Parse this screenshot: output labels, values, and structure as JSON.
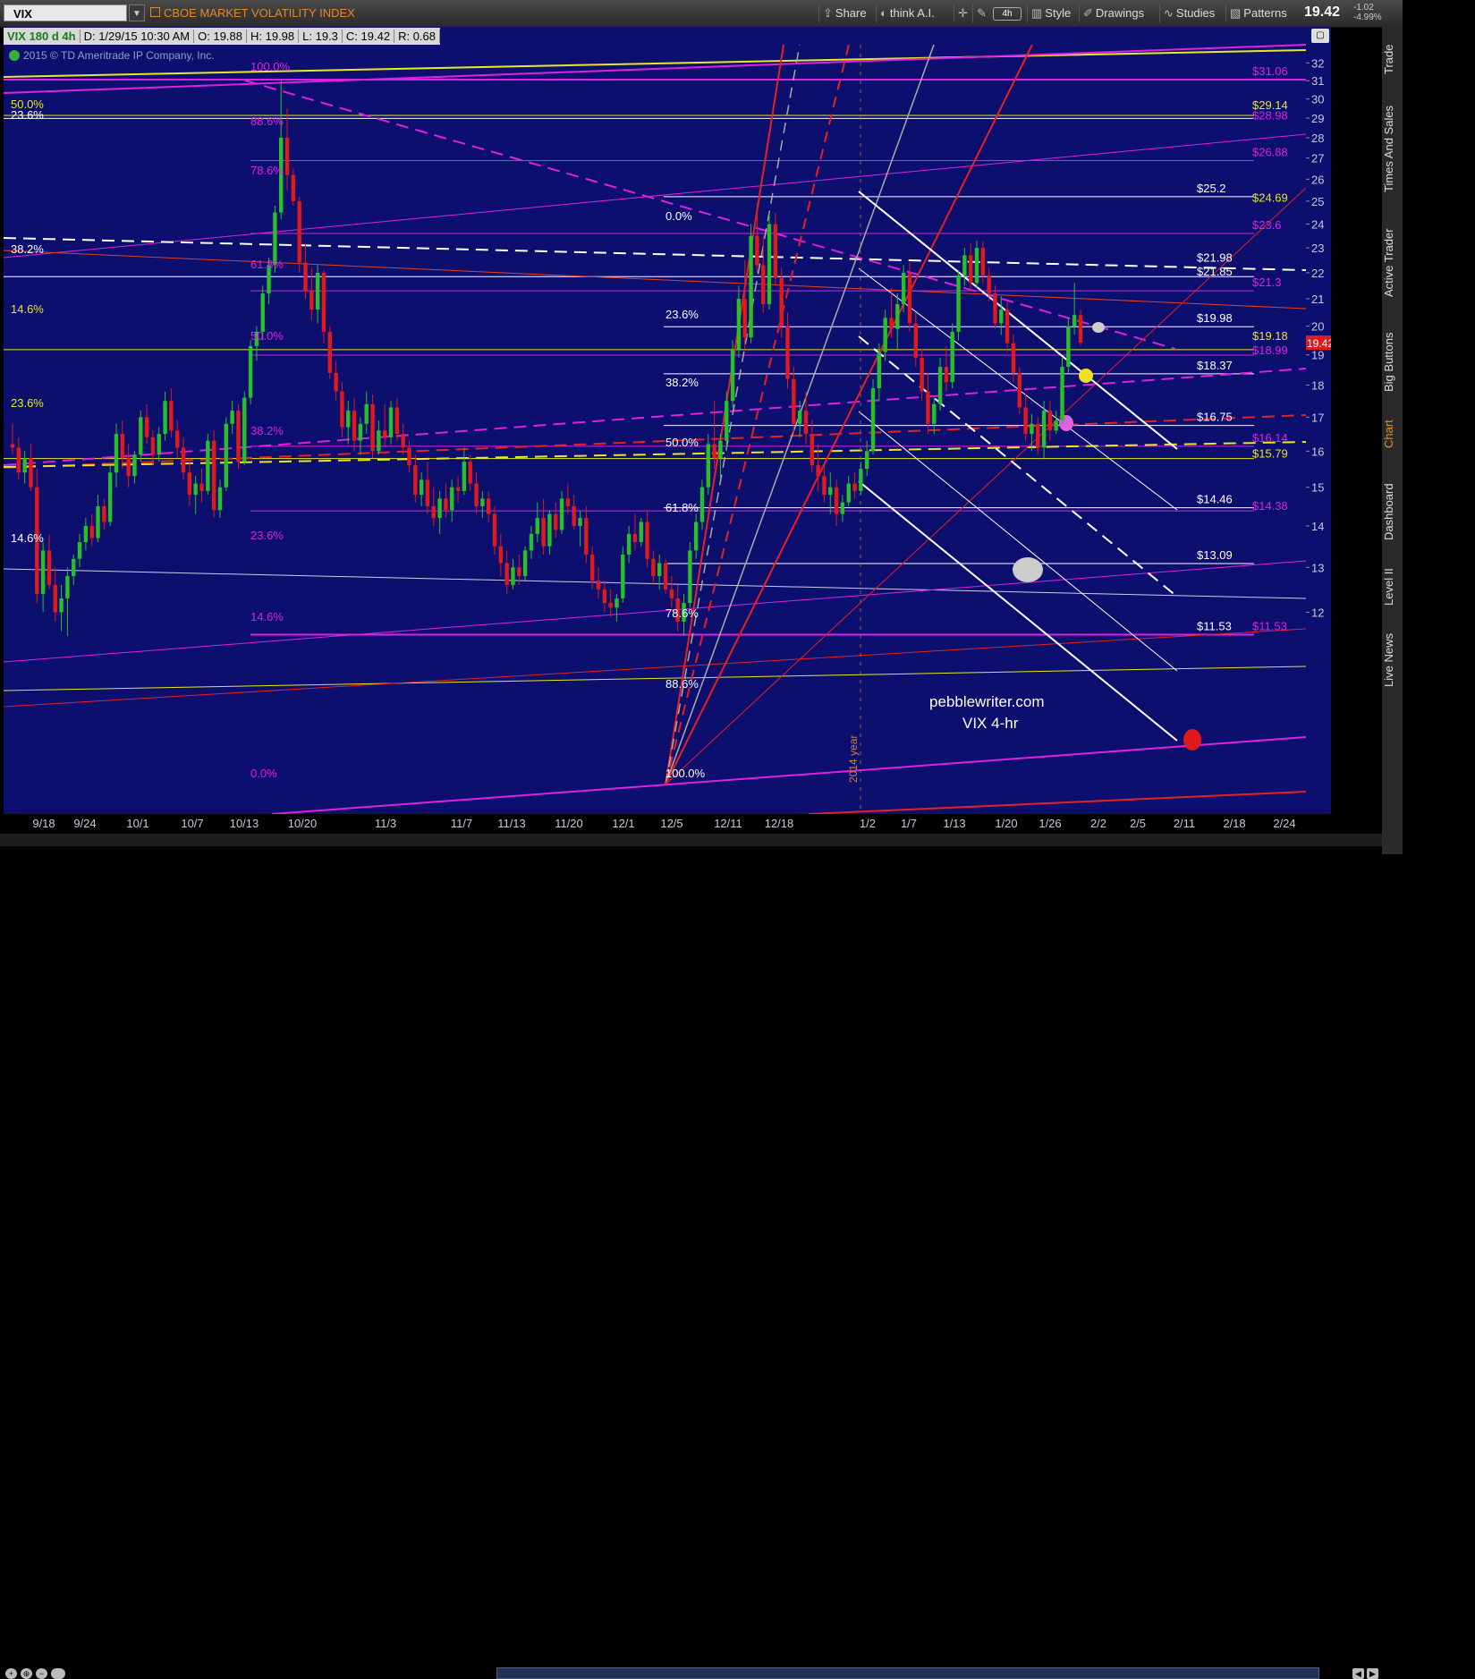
{
  "toolbar": {
    "symbol": "VIX",
    "symbol_name": "CBOE MARKET VOLATILITY INDEX",
    "share": "Share",
    "think": "think A.I.",
    "aggregation": "4h",
    "style": "Style",
    "drawings": "Drawings",
    "studies": "Studies",
    "patterns": "Patterns",
    "last": "19.42",
    "change": "-1.02",
    "change_pct": "-4.99%"
  },
  "info": {
    "sym": "VIX 180 d 4h",
    "date": "D: 1/29/15 10:30 AM",
    "open": "O: 19.88",
    "high": "H: 19.98",
    "low": "L: 19.3",
    "close": "C: 19.42",
    "range": "R: 0.68"
  },
  "copyright": "2015 © TD Ameritrade IP Company, Inc.",
  "sidebar": [
    "Trade",
    "Times And Sales",
    "Active Trader",
    "Big Buttons",
    "Chart",
    "Dashboard",
    "Level II",
    "Live News"
  ],
  "colors": {
    "bg": "#0c0f6e",
    "up": "#28c028",
    "down": "#e01a1a",
    "magenta": "#e020e0",
    "yellow": "#e8e820",
    "red": "#e82020",
    "white": "#ffffff"
  },
  "chart_data": {
    "type": "candlestick",
    "title": "CBOE MARKET VOLATILITY INDEX",
    "x_tick_labels": [
      "9/18",
      "9/24",
      "10/1",
      "10/7",
      "10/13",
      "10/20",
      "11/3",
      "11/7",
      "11/13",
      "11/20",
      "12/1",
      "12/5",
      "12/11",
      "12/18",
      "1/2",
      "1/7",
      "1/13",
      "1/20",
      "1/26",
      "2/2",
      "2/5",
      "2/11",
      "2/18",
      "2/24"
    ],
    "ylim": [
      11,
      32
    ],
    "y_ticks": [
      12,
      13,
      14,
      15,
      16,
      17,
      18,
      19,
      20,
      21,
      22,
      23,
      24,
      25,
      26,
      27,
      28,
      29,
      30,
      31,
      32
    ],
    "last_price": 19.42,
    "price_labels": [
      {
        "text": "$31.06",
        "value": 31.06,
        "color": "#e020e0"
      },
      {
        "text": "$29.14",
        "value": 29.14,
        "color": "#e8e820"
      },
      {
        "text": "$28.98",
        "value": 28.98,
        "color": "#e020e0"
      },
      {
        "text": "$26.88",
        "value": 26.88,
        "color": "#e020e0"
      },
      {
        "text": "$25.2",
        "value": 25.2,
        "color": "#ffffff"
      },
      {
        "text": "$24.69",
        "value": 24.69,
        "color": "#e8e820"
      },
      {
        "text": "$23.6",
        "value": 23.6,
        "color": "#e020e0"
      },
      {
        "text": "$21.98",
        "value": 21.98,
        "color": "#ffffff"
      },
      {
        "text": "$21.85",
        "value": 21.85,
        "color": "#ffffff"
      },
      {
        "text": "$21.3",
        "value": 21.3,
        "color": "#e020e0"
      },
      {
        "text": "$19.98",
        "value": 19.98,
        "color": "#ffffff"
      },
      {
        "text": "$19.18",
        "value": 19.18,
        "color": "#e8e820"
      },
      {
        "text": "$18.99",
        "value": 18.99,
        "color": "#e020e0"
      },
      {
        "text": "$18.37",
        "value": 18.37,
        "color": "#ffffff"
      },
      {
        "text": "$16.75",
        "value": 16.75,
        "color": "#ffffff"
      },
      {
        "text": "$16.14",
        "value": 16.14,
        "color": "#e020e0"
      },
      {
        "text": "$15.79",
        "value": 15.79,
        "color": "#e8e820"
      },
      {
        "text": "$14.46",
        "value": 14.46,
        "color": "#ffffff"
      },
      {
        "text": "$14.38",
        "value": 14.38,
        "color": "#e020e0"
      },
      {
        "text": "$13.09",
        "value": 13.09,
        "color": "#ffffff"
      },
      {
        "text": "$11.53",
        "value": 11.53,
        "color": "#ffffff"
      },
      {
        "text": "$11.53",
        "value": 11.53,
        "color": "#e020e0"
      }
    ],
    "fib_left_white": [
      {
        "text": "50.0%"
      },
      {
        "text": "23.6%"
      },
      {
        "text": "38.2%"
      },
      {
        "text": "14.6%"
      },
      {
        "text": "23.6%"
      },
      {
        "text": "14.6%"
      }
    ],
    "fib_mag": [
      {
        "text": "100.0%"
      },
      {
        "text": "88.6%"
      },
      {
        "text": "78.6%"
      },
      {
        "text": "61.8%"
      },
      {
        "text": "50.0%"
      },
      {
        "text": "38.2%"
      },
      {
        "text": "23.6%"
      },
      {
        "text": "14.6%"
      },
      {
        "text": "0.0%"
      }
    ],
    "fib_mid": [
      {
        "text": "0.0%"
      },
      {
        "text": "23.6%"
      },
      {
        "text": "38.2%"
      },
      {
        "text": "50.0%"
      },
      {
        "text": "61.8%"
      },
      {
        "text": "78.6%"
      },
      {
        "text": "88.6%"
      },
      {
        "text": "100.0%"
      }
    ],
    "annotations": [
      "pebblewriter.com",
      "VIX 4-hr",
      "2014 year"
    ],
    "candles": [
      [
        16.2,
        16.8,
        15.9,
        16.1
      ],
      [
        16.1,
        16.4,
        15.2,
        15.4
      ],
      [
        15.4,
        16.0,
        15.1,
        15.8
      ],
      [
        15.8,
        16.2,
        14.9,
        15.0
      ],
      [
        15.0,
        15.5,
        12.2,
        12.4
      ],
      [
        12.4,
        13.6,
        12.0,
        13.4
      ],
      [
        13.4,
        13.8,
        12.5,
        12.6
      ],
      [
        12.6,
        13.0,
        11.8,
        12.0
      ],
      [
        12.0,
        12.6,
        11.6,
        12.3
      ],
      [
        12.3,
        13.0,
        11.5,
        12.8
      ],
      [
        12.8,
        13.3,
        12.6,
        13.2
      ],
      [
        13.2,
        13.8,
        13.0,
        13.6
      ],
      [
        13.6,
        14.2,
        13.4,
        14.0
      ],
      [
        14.0,
        14.3,
        13.5,
        13.7
      ],
      [
        13.7,
        14.8,
        13.6,
        14.5
      ],
      [
        14.5,
        14.7,
        13.9,
        14.1
      ],
      [
        14.1,
        15.6,
        14.0,
        15.4
      ],
      [
        15.4,
        16.8,
        15.0,
        16.5
      ],
      [
        16.5,
        16.9,
        15.5,
        15.8
      ],
      [
        15.8,
        16.2,
        15.0,
        15.3
      ],
      [
        15.3,
        16.0,
        15.1,
        15.9
      ],
      [
        15.9,
        17.2,
        15.7,
        17.0
      ],
      [
        17.0,
        17.4,
        16.2,
        16.4
      ],
      [
        16.4,
        16.6,
        15.6,
        15.9
      ],
      [
        15.9,
        16.7,
        15.7,
        16.5
      ],
      [
        16.5,
        17.8,
        16.3,
        17.5
      ],
      [
        17.5,
        17.9,
        16.4,
        16.6
      ],
      [
        16.6,
        16.9,
        15.8,
        16.1
      ],
      [
        16.1,
        16.4,
        15.2,
        15.4
      ],
      [
        15.4,
        15.8,
        14.5,
        14.8
      ],
      [
        14.8,
        15.3,
        14.3,
        15.1
      ],
      [
        15.1,
        15.5,
        14.6,
        14.9
      ],
      [
        14.9,
        16.5,
        14.8,
        16.3
      ],
      [
        16.3,
        16.6,
        14.2,
        14.4
      ],
      [
        14.4,
        15.2,
        14.2,
        15.0
      ],
      [
        15.0,
        17.0,
        14.9,
        16.8
      ],
      [
        16.8,
        17.5,
        16.5,
        17.2
      ],
      [
        17.2,
        17.4,
        15.5,
        15.7
      ],
      [
        15.7,
        17.8,
        15.6,
        17.6
      ],
      [
        17.6,
        19.5,
        17.4,
        19.3
      ],
      [
        19.3,
        20.0,
        18.8,
        19.8
      ],
      [
        19.8,
        21.5,
        19.5,
        21.2
      ],
      [
        21.2,
        22.6,
        20.8,
        22.3
      ],
      [
        22.3,
        24.8,
        22.0,
        24.5
      ],
      [
        24.5,
        31.0,
        24.2,
        28.0
      ],
      [
        28.0,
        29.5,
        25.5,
        26.2
      ],
      [
        26.2,
        26.5,
        24.8,
        25.0
      ],
      [
        25.0,
        25.2,
        22.0,
        22.4
      ],
      [
        22.4,
        23.2,
        21.0,
        21.3
      ],
      [
        21.3,
        22.2,
        20.2,
        20.6
      ],
      [
        20.6,
        22.3,
        20.1,
        22.0
      ],
      [
        22.0,
        22.1,
        19.4,
        19.8
      ],
      [
        19.8,
        20.0,
        18.2,
        18.4
      ],
      [
        18.4,
        18.8,
        17.5,
        17.8
      ],
      [
        17.8,
        18.1,
        16.4,
        16.7
      ],
      [
        16.7,
        17.5,
        16.2,
        17.2
      ],
      [
        17.2,
        17.6,
        16.0,
        16.3
      ],
      [
        16.3,
        17.0,
        15.9,
        16.8
      ],
      [
        16.8,
        17.8,
        16.5,
        17.4
      ],
      [
        17.4,
        17.7,
        15.8,
        16.0
      ],
      [
        16.0,
        16.9,
        15.9,
        16.6
      ],
      [
        16.6,
        17.4,
        16.1,
        16.4
      ],
      [
        16.4,
        17.5,
        16.2,
        17.3
      ],
      [
        17.3,
        17.6,
        16.3,
        16.5
      ],
      [
        16.5,
        16.8,
        15.9,
        16.1
      ],
      [
        16.1,
        16.3,
        15.4,
        15.6
      ],
      [
        15.6,
        15.9,
        14.6,
        14.8
      ],
      [
        14.8,
        15.4,
        14.5,
        15.2
      ],
      [
        15.2,
        15.7,
        14.3,
        14.5
      ],
      [
        14.5,
        15.0,
        14.0,
        14.2
      ],
      [
        14.2,
        14.9,
        13.8,
        14.7
      ],
      [
        14.7,
        15.1,
        14.2,
        14.4
      ],
      [
        14.4,
        15.2,
        14.1,
        15.0
      ],
      [
        15.0,
        15.3,
        14.6,
        14.9
      ],
      [
        14.9,
        16.1,
        14.8,
        15.7
      ],
      [
        15.7,
        15.9,
        14.9,
        15.1
      ],
      [
        15.1,
        15.4,
        14.3,
        14.5
      ],
      [
        14.5,
        14.9,
        14.2,
        14.7
      ],
      [
        14.7,
        14.9,
        14.1,
        14.3
      ],
      [
        14.3,
        14.5,
        13.3,
        13.5
      ],
      [
        13.5,
        13.8,
        12.8,
        13.1
      ],
      [
        13.1,
        13.4,
        12.4,
        12.6
      ],
      [
        12.6,
        13.2,
        12.5,
        13.0
      ],
      [
        13.0,
        13.3,
        12.6,
        12.8
      ],
      [
        12.8,
        13.5,
        12.7,
        13.4
      ],
      [
        13.4,
        14.0,
        13.2,
        13.8
      ],
      [
        13.8,
        14.6,
        13.6,
        14.2
      ],
      [
        14.2,
        14.7,
        13.3,
        13.5
      ],
      [
        13.5,
        14.4,
        13.3,
        14.3
      ],
      [
        14.3,
        14.6,
        13.7,
        13.9
      ],
      [
        13.9,
        14.9,
        13.8,
        14.7
      ],
      [
        14.7,
        15.1,
        14.3,
        14.5
      ],
      [
        14.5,
        14.8,
        13.9,
        14.0
      ],
      [
        14.0,
        14.4,
        13.5,
        14.2
      ],
      [
        14.2,
        14.5,
        13.1,
        13.3
      ],
      [
        13.3,
        13.5,
        12.5,
        12.7
      ],
      [
        12.7,
        13.0,
        12.3,
        12.5
      ],
      [
        12.5,
        12.7,
        12.0,
        12.2
      ],
      [
        12.2,
        12.5,
        11.9,
        12.1
      ],
      [
        12.1,
        12.4,
        11.8,
        12.3
      ],
      [
        12.3,
        13.5,
        12.2,
        13.3
      ],
      [
        13.3,
        14.0,
        13.1,
        13.8
      ],
      [
        13.8,
        14.3,
        13.4,
        13.6
      ],
      [
        13.6,
        14.2,
        13.5,
        14.1
      ],
      [
        14.1,
        14.4,
        13.0,
        13.2
      ],
      [
        13.2,
        13.4,
        12.6,
        12.8
      ],
      [
        12.8,
        13.3,
        12.5,
        13.1
      ],
      [
        13.1,
        13.2,
        12.4,
        12.5
      ],
      [
        12.5,
        12.8,
        12.1,
        12.3
      ],
      [
        12.3,
        12.6,
        11.6,
        11.8
      ],
      [
        11.8,
        12.4,
        11.5,
        12.2
      ],
      [
        12.2,
        13.6,
        12.1,
        13.4
      ],
      [
        13.4,
        14.3,
        13.2,
        14.1
      ],
      [
        14.1,
        15.2,
        13.9,
        15.0
      ],
      [
        15.0,
        16.5,
        14.8,
        16.2
      ],
      [
        16.2,
        17.5,
        15.5,
        15.8
      ],
      [
        15.8,
        16.5,
        15.2,
        16.3
      ],
      [
        16.3,
        17.8,
        16.0,
        17.5
      ],
      [
        17.5,
        19.5,
        17.3,
        19.2
      ],
      [
        19.2,
        21.5,
        18.9,
        21.0
      ],
      [
        21.0,
        22.5,
        19.2,
        19.6
      ],
      [
        19.6,
        24.0,
        19.4,
        23.5
      ],
      [
        23.5,
        24.9,
        22.0,
        22.3
      ],
      [
        22.3,
        23.5,
        20.5,
        20.8
      ],
      [
        20.8,
        24.5,
        20.6,
        24.0
      ],
      [
        24.0,
        24.5,
        21.5,
        21.8
      ],
      [
        21.8,
        22.2,
        19.6,
        20.0
      ],
      [
        20.0,
        20.5,
        17.9,
        18.2
      ],
      [
        18.2,
        18.6,
        16.5,
        16.8
      ],
      [
        16.8,
        17.5,
        16.4,
        17.2
      ],
      [
        17.2,
        17.8,
        16.2,
        16.5
      ],
      [
        16.5,
        16.9,
        15.4,
        15.6
      ],
      [
        15.6,
        16.2,
        14.9,
        15.3
      ],
      [
        15.3,
        15.6,
        14.6,
        14.8
      ],
      [
        14.8,
        15.4,
        14.3,
        15.0
      ],
      [
        15.0,
        15.2,
        14.0,
        14.3
      ],
      [
        14.3,
        14.8,
        14.1,
        14.6
      ],
      [
        14.6,
        15.3,
        14.5,
        15.1
      ],
      [
        15.1,
        15.4,
        14.7,
        14.9
      ],
      [
        14.9,
        15.7,
        14.8,
        15.5
      ],
      [
        15.5,
        16.3,
        15.3,
        16.0
      ],
      [
        16.0,
        18.2,
        15.9,
        17.9
      ],
      [
        17.9,
        19.4,
        17.5,
        19.1
      ],
      [
        19.1,
        20.6,
        18.8,
        20.3
      ],
      [
        20.3,
        21.4,
        19.6,
        19.9
      ],
      [
        19.9,
        21.2,
        19.2,
        20.8
      ],
      [
        20.8,
        22.3,
        20.5,
        22.0
      ],
      [
        22.0,
        22.4,
        19.8,
        20.1
      ],
      [
        20.1,
        20.5,
        18.6,
        18.9
      ],
      [
        18.9,
        19.2,
        17.5,
        17.8
      ],
      [
        17.8,
        18.4,
        16.5,
        16.8
      ],
      [
        16.8,
        17.6,
        16.5,
        17.4
      ],
      [
        17.4,
        18.9,
        17.2,
        18.6
      ],
      [
        18.6,
        19.3,
        17.8,
        18.1
      ],
      [
        18.1,
        20.1,
        17.9,
        19.8
      ],
      [
        19.8,
        22.1,
        19.5,
        21.9
      ],
      [
        21.9,
        23.0,
        21.5,
        22.7
      ],
      [
        22.7,
        23.2,
        21.3,
        21.6
      ],
      [
        21.6,
        23.3,
        21.4,
        23.0
      ],
      [
        23.0,
        23.3,
        21.6,
        21.9
      ],
      [
        21.9,
        22.2,
        20.9,
        21.2
      ],
      [
        21.2,
        21.5,
        19.9,
        20.1
      ],
      [
        20.1,
        21.1,
        19.7,
        20.6
      ],
      [
        20.6,
        20.9,
        19.1,
        19.4
      ],
      [
        19.4,
        19.7,
        18.1,
        18.4
      ],
      [
        18.4,
        18.6,
        17.1,
        17.3
      ],
      [
        17.3,
        17.7,
        16.3,
        16.5
      ],
      [
        16.5,
        17.1,
        16.0,
        16.8
      ],
      [
        16.8,
        17.0,
        15.9,
        16.1
      ],
      [
        16.1,
        17.5,
        15.8,
        17.2
      ],
      [
        17.2,
        17.5,
        16.3,
        16.6
      ],
      [
        16.6,
        17.2,
        16.5,
        16.9
      ],
      [
        16.9,
        18.9,
        16.8,
        18.6
      ],
      [
        18.6,
        20.3,
        18.4,
        20.0
      ],
      [
        20.0,
        21.6,
        19.7,
        20.4
      ],
      [
        20.4,
        20.6,
        19.3,
        19.42
      ]
    ]
  }
}
